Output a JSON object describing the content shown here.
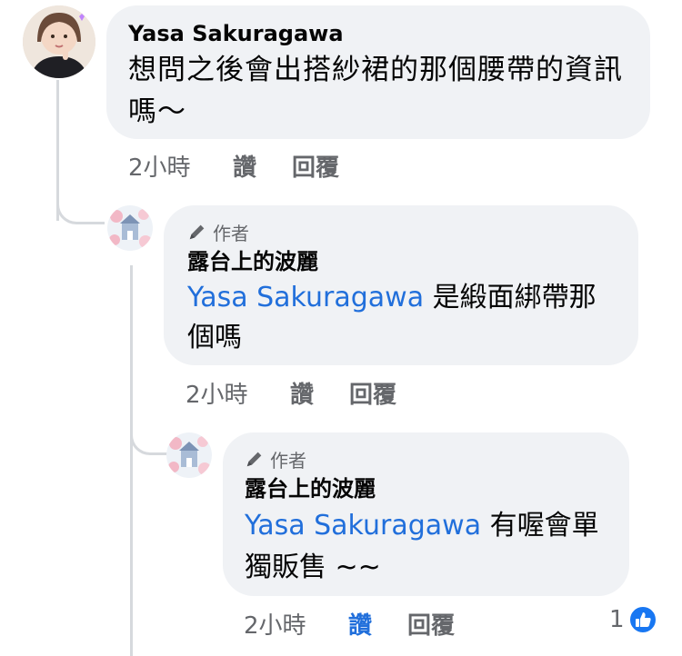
{
  "comments": [
    {
      "author": "Yasa Sakuragawa",
      "text": "想問之後會出搭紗裙的那個腰帶的資訊嗎～",
      "time": "2小時",
      "like": "讚",
      "reply": "回覆"
    },
    {
      "badge": "作者",
      "author": "露台上的波麗",
      "mention": "Yasa Sakuragawa",
      "text": " 是緞面綁帶那個嗎",
      "time": "2小時",
      "like": "讚",
      "reply": "回覆"
    },
    {
      "badge": "作者",
      "author": "露台上的波麗",
      "mention": "Yasa Sakuragawa",
      "text": " 有喔會單獨販售 ~~",
      "time": "2小時",
      "like": "讚",
      "reply": "回覆",
      "reaction_count": "1",
      "liked_by_viewer": true
    }
  ],
  "icons": {
    "pen": "pen-icon",
    "like_reaction": "thumbs-up-icon"
  },
  "colors": {
    "bubble": "#f0f2f5",
    "mention": "#216fdb",
    "meta": "#65676b",
    "thread": "#d6d9dd"
  }
}
